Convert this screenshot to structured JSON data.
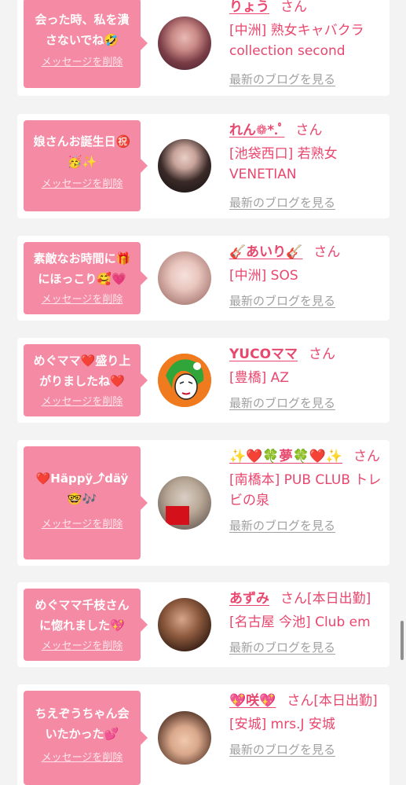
{
  "theme": {
    "accent": "#e8476e",
    "bubble": "#f48aa3",
    "background": "#f3f3f3",
    "link_muted": "#a0a0a0"
  },
  "cards": [
    {
      "message": "会った時、私を潰\nさないでね🤣",
      "delete_label": "メッセージを削除",
      "name": "りょう",
      "honorific": "さん",
      "shop": "[中洲] 熟女キャバクラ collection second",
      "blog_label": "最新のブログを見る"
    },
    {
      "message": "娘さんお誕生日㊗️\n🥳✨",
      "delete_label": "メッセージを削除",
      "name": "れん❁*.ﾟ",
      "honorific": "さん",
      "shop": "[池袋西口] 若熟女 VENETIAN",
      "blog_label": "最新のブログを見る"
    },
    {
      "message": "素敵なお時間に🎁\nにほっこり🥰💗",
      "delete_label": "メッセージを削除",
      "name": "🎸あいり🎸",
      "honorific": "さん",
      "shop": "[中洲] SOS",
      "blog_label": "最新のブログを見る"
    },
    {
      "message": "めぐママ❤️盛り上\nがりましたね❤️",
      "delete_label": "メッセージを削除",
      "name": "YUCOママ",
      "honorific": "さん",
      "shop": "[豊橋] AZ",
      "blog_label": "最新のブログを見る"
    },
    {
      "message": "❤️Häppÿ⤴︎däÿ\n🤓🎶",
      "delete_label": "メッセージを削除",
      "name": "✨❤️🍀夢🍀❤️✨",
      "honorific": "さん",
      "shop": "[南橋本] PUB CLUB トレビの泉",
      "blog_label": "最新のブログを見る"
    },
    {
      "message": "めぐママ千枝さん\nに惚れました💖",
      "delete_label": "メッセージを削除",
      "name": "あずみ",
      "honorific": "さん[本日出勤]",
      "shop": "[名古屋 今池] Club em",
      "blog_label": "最新のブログを見る"
    },
    {
      "message": "ちえぞうちゃん会\nいたかった💕",
      "delete_label": "メッセージを削除",
      "name": "💖咲💖",
      "honorific": "さん[本日出勤]",
      "shop": "[安城] mrs.J 安城",
      "blog_label": "最新のブログを見る"
    }
  ]
}
